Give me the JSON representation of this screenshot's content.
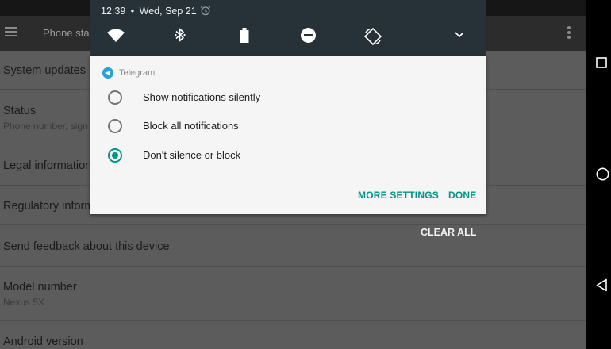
{
  "settings_screen": {
    "toolbar_title": "Phone sta",
    "items": [
      {
        "title": "System updates",
        "subtitle": ""
      },
      {
        "title": "Status",
        "subtitle": "Phone number, sign"
      },
      {
        "title": "Legal information",
        "subtitle": ""
      },
      {
        "title": "Regulatory inform",
        "subtitle": ""
      },
      {
        "title": "Send feedback about this device",
        "subtitle": ""
      },
      {
        "title": "Model number",
        "subtitle": "Nexus 5X"
      },
      {
        "title": "Android version",
        "subtitle": ""
      }
    ]
  },
  "shade": {
    "time": "12:39",
    "separator": "•",
    "date": "Wed, Sep 21",
    "quick_settings": [
      "wifi-icon",
      "bluetooth-icon",
      "battery-icon",
      "do-not-disturb-icon",
      "auto-rotate-icon",
      "expand-icon"
    ]
  },
  "notification": {
    "app_name": "Telegram",
    "options": [
      {
        "label": "Show notifications silently",
        "selected": false
      },
      {
        "label": "Block all notifications",
        "selected": false
      },
      {
        "label": "Don't silence or block",
        "selected": true
      }
    ],
    "actions": {
      "more_settings": "MORE SETTINGS",
      "done": "DONE"
    }
  },
  "clear_all": "CLEAR ALL",
  "navigation": [
    "recents-icon",
    "home-icon",
    "back-icon"
  ],
  "colors": {
    "accent": "#009688",
    "shade_bg": "#263238",
    "telegram": "#2aa3dd"
  }
}
